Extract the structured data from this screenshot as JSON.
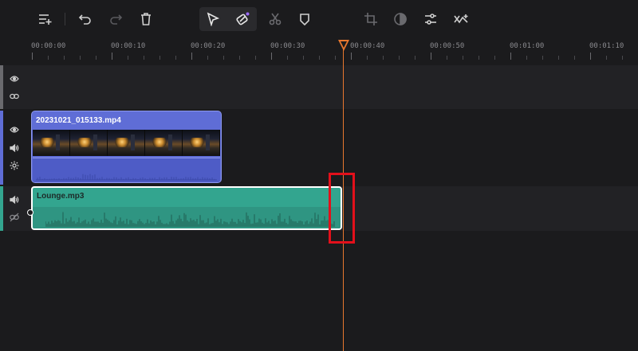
{
  "toolbar": {
    "items": [
      {
        "name": "add-track-icon"
      },
      {
        "name": "undo-icon"
      },
      {
        "name": "redo-icon"
      },
      {
        "name": "delete-icon"
      },
      {
        "name": "select-tool-icon"
      },
      {
        "name": "razor-tool-icon"
      },
      {
        "name": "split-icon"
      },
      {
        "name": "mark-icon"
      },
      {
        "name": "crop-icon"
      },
      {
        "name": "color-icon"
      },
      {
        "name": "adjust-icon"
      },
      {
        "name": "speed-icon"
      }
    ]
  },
  "ruler": {
    "labels": [
      "00:00:00",
      "00:00:10",
      "00:00:20",
      "00:00:30",
      "00:00:40",
      "00:00:50",
      "00:01:00",
      "00:01:10"
    ]
  },
  "tracks": {
    "empty": {
      "icons": [
        "eye-icon",
        "link-icon"
      ]
    },
    "video": {
      "icons": [
        "eye-icon",
        "volume-icon",
        "effects-icon"
      ]
    },
    "audio": {
      "icons": [
        "volume-icon",
        "unlink-icon"
      ]
    }
  },
  "clips": {
    "video": {
      "filename": "20231021_015133.mp4"
    },
    "audio": {
      "filename": "Lounge.mp3"
    }
  },
  "playhead": {
    "time": "00:00:39"
  },
  "colors": {
    "background": "#1b1b1d",
    "video_clip": "#5f6dd6",
    "audio_clip": "#33a58f",
    "playhead": "#e8772e",
    "highlight": "#e3101b"
  }
}
